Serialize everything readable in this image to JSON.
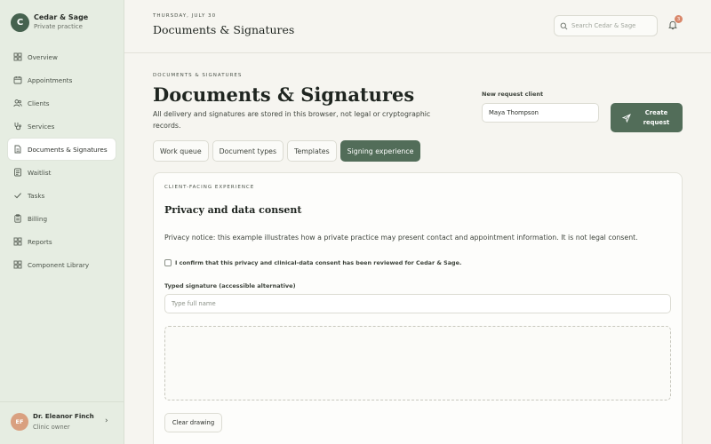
{
  "sidebar": {
    "brand_initial": "C",
    "brand_name": "Cedar & Sage",
    "brand_sub": "Private practice",
    "items": [
      {
        "label": "Overview",
        "icon": "grid-icon"
      },
      {
        "label": "Appointments",
        "icon": "calendar-icon"
      },
      {
        "label": "Clients",
        "icon": "users-icon"
      },
      {
        "label": "Services",
        "icon": "stethoscope-icon"
      },
      {
        "label": "Documents & Signatures",
        "icon": "document-signature-icon",
        "active": true
      },
      {
        "label": "Waitlist",
        "icon": "list-icon"
      },
      {
        "label": "Tasks",
        "icon": "check-icon"
      },
      {
        "label": "Billing",
        "icon": "clipboard-icon"
      },
      {
        "label": "Reports",
        "icon": "grid-icon"
      },
      {
        "label": "Component Library",
        "icon": "grid-icon"
      }
    ],
    "user": {
      "initials": "EF",
      "name": "Dr. Eleanor Finch",
      "role": "Clinic owner"
    }
  },
  "header": {
    "date": "THURSDAY, JULY 30",
    "title": "Documents & Signatures",
    "search_placeholder": "Search Cedar & Sage",
    "notification_count": "3"
  },
  "main": {
    "eyebrow": "DOCUMENTS & SIGNATURES",
    "title": "Documents & Signatures",
    "description": "All delivery and signatures are stored in this browser, not legal or cryptographic records.",
    "request": {
      "label": "New request client",
      "value": "Maya Thompson",
      "button_label": "Create request"
    },
    "tabs": [
      {
        "label": "Work queue"
      },
      {
        "label": "Document types"
      },
      {
        "label": "Templates"
      },
      {
        "label": "Signing experience",
        "active": true
      }
    ],
    "card": {
      "eyebrow": "CLIENT-FACING EXPERIENCE",
      "title": "Privacy and data consent",
      "notice": "Privacy notice: this example illustrates how a private practice may present contact and appointment information. It is not legal consent.",
      "consent_label": "I confirm that this privacy and clinical-data consent has been reviewed for Cedar & Sage.",
      "consent_checked": false,
      "signature_label": "Typed signature (accessible alternative)",
      "signature_placeholder": "Type full name",
      "signature_value": "",
      "clear_label": "Clear drawing"
    }
  },
  "colors": {
    "accent": "#526d59",
    "sidebar_bg": "#e6ede2",
    "page_bg": "#f6f5f0",
    "badge": "#d9876a"
  }
}
